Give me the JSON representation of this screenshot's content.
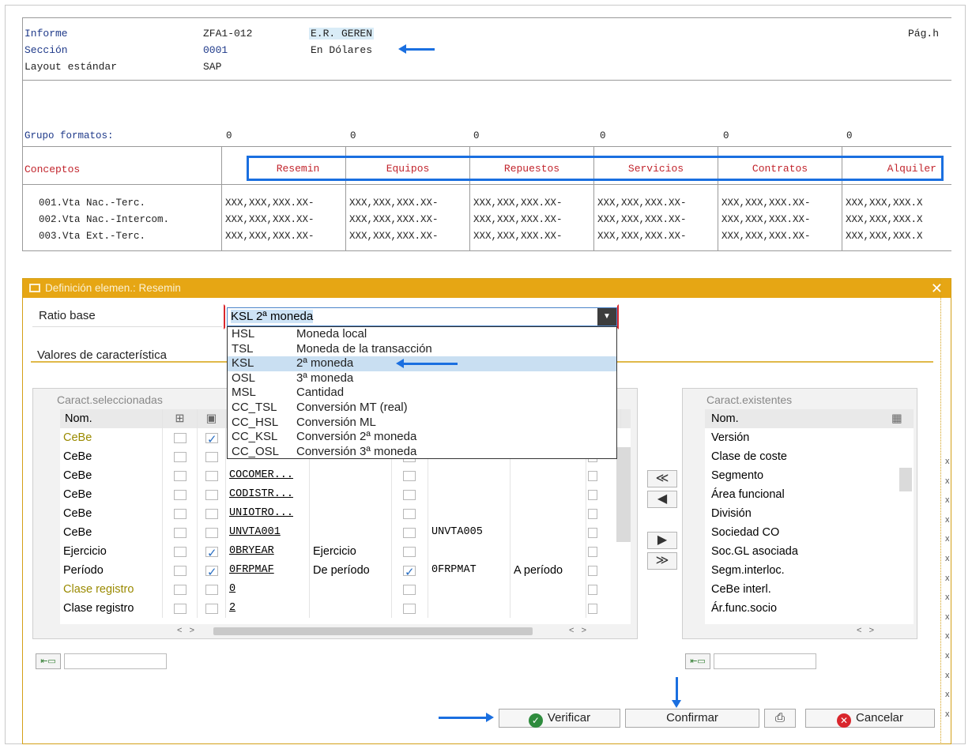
{
  "report": {
    "header": [
      {
        "label": "Informe",
        "code": "ZFA1-012",
        "desc": "E.R. GEREN",
        "extra": "Pág.h"
      },
      {
        "label": "Sección",
        "code": "0001",
        "desc": "En Dólares"
      },
      {
        "label": "Layout estándar",
        "code": "SAP",
        "desc": ""
      }
    ],
    "format_group_label": "Grupo formatos:",
    "format_group_values": [
      "0",
      "0",
      "0",
      "0",
      "0",
      "0"
    ],
    "concepts_label": "Conceptos",
    "columns": [
      "Resemin",
      "Equipos",
      "Repuestos",
      "Servicios",
      "Contratos",
      "Alquiler"
    ],
    "rows": [
      {
        "label": "001.Vta Nac.-Terc.",
        "cells": [
          "XXX,XXX,XXX.XX-",
          "XXX,XXX,XXX.XX-",
          "XXX,XXX,XXX.XX-",
          "XXX,XXX,XXX.XX-",
          "XXX,XXX,XXX.XX-",
          "XXX,XXX,XXX.X"
        ]
      },
      {
        "label": "002.Vta Nac.-Intercom.",
        "cells": [
          "XXX,XXX,XXX.XX-",
          "XXX,XXX,XXX.XX-",
          "XXX,XXX,XXX.XX-",
          "XXX,XXX,XXX.XX-",
          "XXX,XXX,XXX.XX-",
          "XXX,XXX,XXX.X"
        ]
      },
      {
        "label": "003.Vta Ext.-Terc.",
        "cells": [
          "XXX,XXX,XXX.XX-",
          "XXX,XXX,XXX.XX-",
          "XXX,XXX,XXX.XX-",
          "XXX,XXX,XXX.XX-",
          "XXX,XXX,XXX.XX-",
          "XXX,XXX,XXX.X"
        ]
      }
    ]
  },
  "dialog": {
    "title": "Definición elemen.: Resemin",
    "close": "✕",
    "ratio_label": "Ratio base",
    "ratio_value": "KSL 2ª moneda",
    "values_label": "Valores de característica",
    "options": [
      {
        "code": "HSL",
        "text": "Moneda local"
      },
      {
        "code": "TSL",
        "text": "Moneda de la transacción"
      },
      {
        "code": "KSL",
        "text": "2ª moneda"
      },
      {
        "code": "OSL",
        "text": "3ª moneda"
      },
      {
        "code": "MSL",
        "text": "Cantidad"
      },
      {
        "code": "CC_TSL",
        "text": "Conversión MT (real)"
      },
      {
        "code": "CC_HSL",
        "text": "Conversión ML"
      },
      {
        "code": "CC_KSL",
        "text": "Conversión 2ª moneda"
      },
      {
        "code": "CC_OSL",
        "text": "Conversión 3ª moneda"
      }
    ],
    "selected_option_index": 2,
    "left_panel": {
      "title": "Caract.seleccionadas",
      "header": "Nom.",
      "rows": [
        {
          "name": "CeBe",
          "olive": true,
          "c1": false,
          "c2": true,
          "val": "",
          "desc": "",
          "c3": false,
          "val2": "",
          "desc2": ""
        },
        {
          "name": "CeBe",
          "olive": false,
          "c1": false,
          "c2": false,
          "val": "",
          "desc": "",
          "c3": false,
          "val2": "",
          "desc2": ""
        },
        {
          "name": "CeBe",
          "olive": false,
          "c1": false,
          "c2": false,
          "val": "COCOMER...",
          "desc": "",
          "c3": false,
          "val2": "",
          "desc2": ""
        },
        {
          "name": "CeBe",
          "olive": false,
          "c1": false,
          "c2": false,
          "val": "CODISTR...",
          "desc": "",
          "c3": false,
          "val2": "",
          "desc2": ""
        },
        {
          "name": "CeBe",
          "olive": false,
          "c1": false,
          "c2": false,
          "val": "UNIOTRO...",
          "desc": "",
          "c3": false,
          "val2": "",
          "desc2": ""
        },
        {
          "name": "CeBe",
          "olive": false,
          "c1": false,
          "c2": false,
          "val": "UNVTA001",
          "desc": "",
          "c3": false,
          "val2": "UNVTA005",
          "desc2": ""
        },
        {
          "name": "Ejercicio",
          "olive": false,
          "c1": false,
          "c2": true,
          "val": "0BRYEAR",
          "desc": "Ejercicio",
          "c3": false,
          "val2": "",
          "desc2": ""
        },
        {
          "name": "Período",
          "olive": false,
          "c1": false,
          "c2": true,
          "val": "0FRPMAF",
          "desc": "De período",
          "c3": true,
          "val2": "0FRPMAT",
          "desc2": "A período"
        },
        {
          "name": "Clase registro",
          "olive": true,
          "c1": false,
          "c2": false,
          "val": "0",
          "desc": "",
          "c3": false,
          "val2": "",
          "desc2": ""
        },
        {
          "name": "Clase registro",
          "olive": false,
          "c1": false,
          "c2": false,
          "val": "2",
          "desc": "",
          "c3": false,
          "val2": "",
          "desc2": ""
        }
      ]
    },
    "right_panel": {
      "title": "Caract.existentes",
      "header": "Nom.",
      "items": [
        "Versión",
        "Clase de coste",
        "Segmento",
        "Área funcional",
        "División",
        "Sociedad CO",
        "Soc.GL asociada",
        "Segm.interloc.",
        "CeBe interl.",
        "Ár.func.socio"
      ]
    },
    "move_buttons": [
      "≪",
      "◀",
      "▶",
      "≫"
    ],
    "buttons": {
      "verify": "Verificar",
      "confirm": "Confirmar",
      "cancel": "Cancelar"
    },
    "right_edge_marks": [
      "x",
      "x",
      "x",
      "x",
      "x",
      "x",
      "x",
      "x",
      "x",
      "x",
      "x",
      "x",
      "x",
      "x"
    ]
  },
  "colors": {
    "dialog_title": "#e6a614",
    "highlight_box": "#1a6fe0",
    "report_red": "#c2252d",
    "report_blue": "#1f3a8a"
  }
}
